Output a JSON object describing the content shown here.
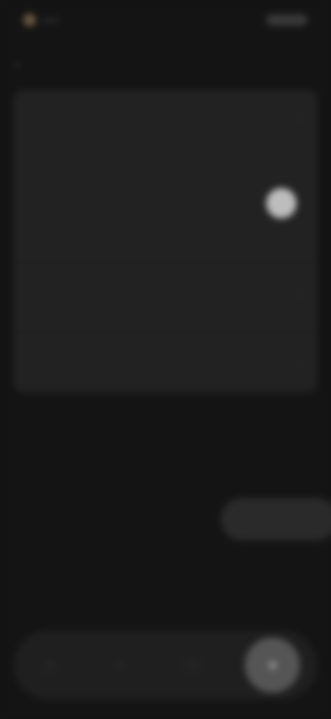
{
  "status_bar": {
    "left_text": "••••"
  },
  "header": {
    "title": ""
  },
  "settings": {
    "section_title": "",
    "section_subtitle": "",
    "toggle_lines": [
      "",
      "",
      ""
    ],
    "toggle_state": "on",
    "rows": [
      {
        "label": ""
      },
      {
        "label": ""
      }
    ]
  },
  "floating_button": {
    "label": ""
  },
  "bottom_nav": {
    "items": [
      {
        "icon": "home-icon",
        "glyph": "⌂"
      },
      {
        "icon": "search-icon",
        "glyph": "○"
      },
      {
        "icon": "library-icon",
        "glyph": "□"
      },
      {
        "icon": "profile-icon",
        "glyph": "●"
      }
    ],
    "active_index": 3
  },
  "colors": {
    "background": "#141414",
    "card": "#222222",
    "toggle_knob": "#bdbdbd",
    "active_nav": "#555555"
  }
}
